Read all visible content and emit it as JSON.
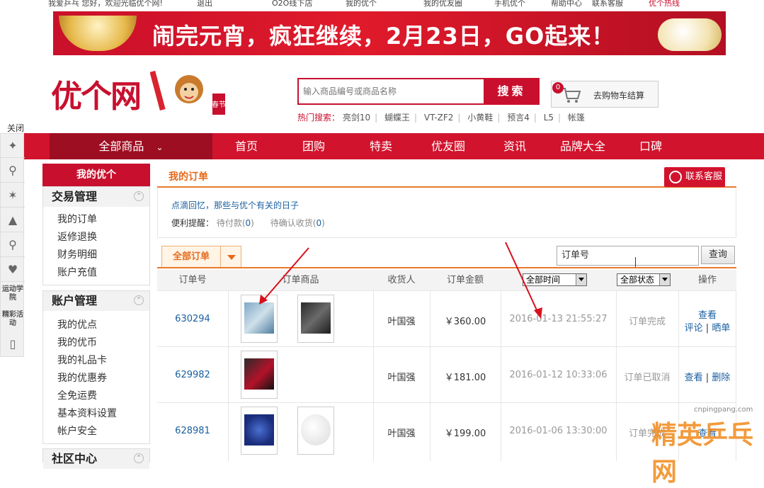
{
  "topbar": {
    "greeting": "我爱乒乓 您好，欢迎光临优个网!",
    "logout": "退出",
    "o2o": "O2O线下店",
    "my_account": "我的优个",
    "my_circle": "我的优友圈",
    "mobile": "手机优个",
    "help": "帮助中心",
    "service": "联系客服",
    "hot_sale": "优个热线"
  },
  "banner": {
    "text": "闹完元宵，疯狂继续，2月23日，GO起来！"
  },
  "header": {
    "logo": "优个网",
    "mascot_badge": "春节",
    "search_placeholder": "输入商品编号或商品名称",
    "search_button": "搜索",
    "hot_label": "热门搜索：",
    "hot_items": [
      "亮剑10",
      "蝴蝶王",
      "VT-ZF2",
      "小黄鞋",
      "预言4",
      "L5",
      "帐篷"
    ],
    "cart_count": "0",
    "cart_label": "去购物车结算"
  },
  "side_tools": {
    "close": "关闭",
    "sports_college": "运动学院",
    "events": "精彩活动"
  },
  "nav": {
    "all_products": "全部商品",
    "items": [
      "首页",
      "团购",
      "特卖",
      "优友圈",
      "资讯",
      "品牌大全",
      "口碑"
    ]
  },
  "left_menu": {
    "header": "我的优个",
    "groups": [
      {
        "title": "交易管理",
        "items": [
          "我的订单",
          "返修退换",
          "财务明细",
          "账户充值"
        ]
      },
      {
        "title": "账户管理",
        "items": [
          "我的优点",
          "我的优币",
          "我的礼品卡",
          "我的优惠券",
          "全免运费",
          "基本资料设置",
          "帐户安全"
        ]
      },
      {
        "title": "社区中心",
        "items": []
      }
    ]
  },
  "main": {
    "title": "我的订单",
    "contact_button": "联系客服",
    "memo": "点滴回忆，那些与优个有关的日子",
    "remind_label": "便利提醒：",
    "pending_pay": "待付款(",
    "pending_pay_count": "0",
    "pending_confirm": "待确认收货(",
    "pending_confirm_count": "0",
    "paren_close": ")",
    "tab_all": "全部订单",
    "search_value": "订单号",
    "query_button": "查询",
    "columns": [
      "订单号",
      "订单商品",
      "收货人",
      "订单金额",
      "操作"
    ],
    "time_filter": "全部时间",
    "status_filter": "全部状态",
    "orders": [
      {
        "id": "630294",
        "receiver": "叶国强",
        "amount": "￥360.00",
        "time": "2016-01-13 21:55:27",
        "status": "订单完成",
        "ops": [
          "查看",
          "评论",
          "晒单"
        ]
      },
      {
        "id": "629982",
        "receiver": "叶国强",
        "amount": "￥181.00",
        "time": "2016-01-12 10:33:06",
        "status": "订单已取消",
        "ops": [
          "查看",
          "删除"
        ]
      },
      {
        "id": "628981",
        "receiver": "叶国强",
        "amount": "￥199.00",
        "time": "2016-01-06 13:30:00",
        "status": "订单完成",
        "ops": [
          "查看"
        ]
      }
    ],
    "op_sep": "|"
  },
  "watermark": {
    "url": "cnpingpang.com",
    "text": "精英乒乓网"
  },
  "colors": {
    "brand_red": "#d2132d",
    "accent_orange": "#e8792b",
    "link_blue": "#1a5fa0"
  }
}
